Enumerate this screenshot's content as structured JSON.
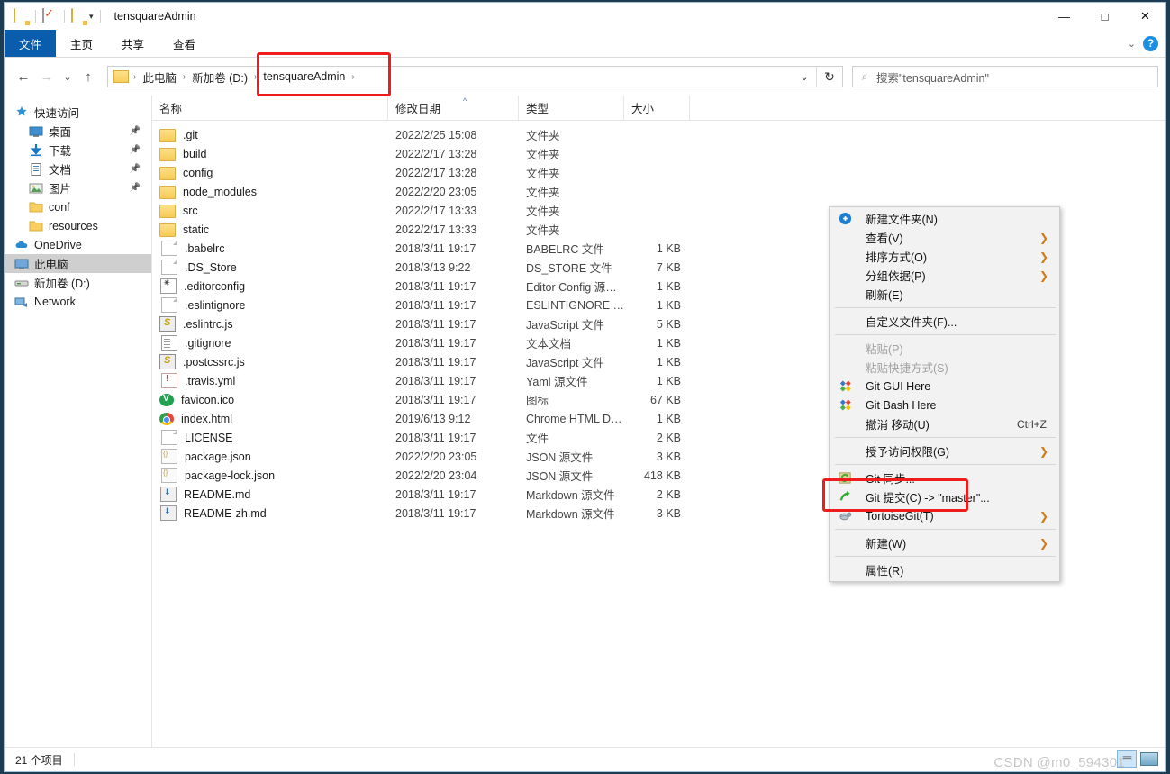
{
  "window": {
    "title": "tensquareAdmin",
    "quick_access_icons": [
      "folder-icon",
      "properties-icon",
      "folder-icon",
      "dropdown-caret-icon"
    ],
    "controls": {
      "minimize": "—",
      "maximize": "□",
      "close": "✕"
    }
  },
  "ribbon": {
    "tabs": [
      {
        "label": "文件",
        "active": true
      },
      {
        "label": "主页",
        "active": false
      },
      {
        "label": "共享",
        "active": false
      },
      {
        "label": "查看",
        "active": false
      }
    ],
    "collapse_caret": "⌄",
    "help_label": "?"
  },
  "addressbar": {
    "back": "←",
    "forward": "→",
    "recent": "⌄",
    "up": "↑",
    "crumbs": [
      "此电脑",
      "新加卷 (D:)",
      "tensquareAdmin"
    ],
    "separator": "›",
    "dropdown_caret": "⌄",
    "refresh": "↻"
  },
  "search": {
    "icon": "search-icon",
    "placeholder": "搜索\"tensquareAdmin\""
  },
  "sidebar": {
    "items": [
      {
        "label": "快速访问",
        "icon": "star-pin-icon",
        "indent": 10,
        "pinned": false,
        "selected": false
      },
      {
        "label": "桌面",
        "icon": "desktop-icon",
        "indent": 26,
        "pinned": true,
        "selected": false
      },
      {
        "label": "下载",
        "icon": "download-icon",
        "indent": 26,
        "pinned": true,
        "selected": false
      },
      {
        "label": "文档",
        "icon": "documents-icon",
        "indent": 26,
        "pinned": true,
        "selected": false
      },
      {
        "label": "图片",
        "icon": "pictures-icon",
        "indent": 26,
        "pinned": true,
        "selected": false
      },
      {
        "label": "conf",
        "icon": "folder-icon",
        "indent": 26,
        "pinned": false,
        "selected": false
      },
      {
        "label": "resources",
        "icon": "folder-icon",
        "indent": 26,
        "pinned": false,
        "selected": false
      },
      {
        "label": "OneDrive",
        "icon": "cloud-icon",
        "indent": 10,
        "pinned": false,
        "selected": false
      },
      {
        "label": "此电脑",
        "icon": "this-pc-icon",
        "indent": 10,
        "pinned": false,
        "selected": true
      },
      {
        "label": "新加卷 (D:)",
        "icon": "drive-icon",
        "indent": 10,
        "pinned": false,
        "selected": false
      },
      {
        "label": "Network",
        "icon": "network-icon",
        "indent": 10,
        "pinned": false,
        "selected": false
      }
    ]
  },
  "filelist": {
    "columns": [
      {
        "label": "名称",
        "key": "name"
      },
      {
        "label": "修改日期",
        "key": "date"
      },
      {
        "label": "类型",
        "key": "type"
      },
      {
        "label": "大小",
        "key": "size"
      }
    ],
    "sort_indicator": "^",
    "rows": [
      {
        "name": ".git",
        "date": "2022/2/25 15:08",
        "type": "文件夹",
        "size": "",
        "icon": "folder-icon"
      },
      {
        "name": "build",
        "date": "2022/2/17 13:28",
        "type": "文件夹",
        "size": "",
        "icon": "folder-icon"
      },
      {
        "name": "config",
        "date": "2022/2/17 13:28",
        "type": "文件夹",
        "size": "",
        "icon": "folder-icon"
      },
      {
        "name": "node_modules",
        "date": "2022/2/20 23:05",
        "type": "文件夹",
        "size": "",
        "icon": "folder-icon"
      },
      {
        "name": "src",
        "date": "2022/2/17 13:33",
        "type": "文件夹",
        "size": "",
        "icon": "folder-icon"
      },
      {
        "name": "static",
        "date": "2022/2/17 13:33",
        "type": "文件夹",
        "size": "",
        "icon": "folder-icon"
      },
      {
        "name": ".babelrc",
        "date": "2018/3/11 19:17",
        "type": "BABELRC 文件",
        "size": "1 KB",
        "icon": "generic-file-icon"
      },
      {
        "name": ".DS_Store",
        "date": "2018/3/13 9:22",
        "type": "DS_STORE 文件",
        "size": "7 KB",
        "icon": "generic-file-icon"
      },
      {
        "name": ".editorconfig",
        "date": "2018/3/11 19:17",
        "type": "Editor Config 源…",
        "size": "1 KB",
        "icon": "config-file-icon"
      },
      {
        "name": ".eslintignore",
        "date": "2018/3/11 19:17",
        "type": "ESLINTIGNORE …",
        "size": "1 KB",
        "icon": "generic-file-icon"
      },
      {
        "name": ".eslintrc.js",
        "date": "2018/3/11 19:17",
        "type": "JavaScript 文件",
        "size": "5 KB",
        "icon": "javascript-file-icon"
      },
      {
        "name": ".gitignore",
        "date": "2018/3/11 19:17",
        "type": "文本文档",
        "size": "1 KB",
        "icon": "text-file-icon"
      },
      {
        "name": ".postcssrc.js",
        "date": "2018/3/11 19:17",
        "type": "JavaScript 文件",
        "size": "1 KB",
        "icon": "javascript-file-icon"
      },
      {
        "name": ".travis.yml",
        "date": "2018/3/11 19:17",
        "type": "Yaml 源文件",
        "size": "1 KB",
        "icon": "yaml-file-icon"
      },
      {
        "name": "favicon.ico",
        "date": "2018/3/11 19:17",
        "type": "图标",
        "size": "67 KB",
        "icon": "favicon-icon"
      },
      {
        "name": "index.html",
        "date": "2019/6/13 9:12",
        "type": "Chrome HTML D…",
        "size": "1 KB",
        "icon": "chrome-html-icon"
      },
      {
        "name": "LICENSE",
        "date": "2018/3/11 19:17",
        "type": "文件",
        "size": "2 KB",
        "icon": "generic-file-icon"
      },
      {
        "name": "package.json",
        "date": "2022/2/20 23:05",
        "type": "JSON 源文件",
        "size": "3 KB",
        "icon": "json-file-icon"
      },
      {
        "name": "package-lock.json",
        "date": "2022/2/20 23:04",
        "type": "JSON 源文件",
        "size": "418 KB",
        "icon": "json-file-icon"
      },
      {
        "name": "README.md",
        "date": "2018/3/11 19:17",
        "type": "Markdown 源文件",
        "size": "2 KB",
        "icon": "markdown-file-icon"
      },
      {
        "name": "README-zh.md",
        "date": "2018/3/11 19:17",
        "type": "Markdown 源文件",
        "size": "3 KB",
        "icon": "markdown-file-icon"
      }
    ]
  },
  "contextmenu": {
    "items": [
      {
        "label": "新建文件夹(N)",
        "icon": "new-folder-icon",
        "arrow": false,
        "accel": "",
        "disabled": false,
        "sep_after": false,
        "highlight": false
      },
      {
        "label": "查看(V)",
        "icon": "",
        "arrow": true,
        "accel": "",
        "disabled": false,
        "sep_after": false,
        "highlight": false
      },
      {
        "label": "排序方式(O)",
        "icon": "",
        "arrow": true,
        "accel": "",
        "disabled": false,
        "sep_after": false,
        "highlight": false
      },
      {
        "label": "分组依据(P)",
        "icon": "",
        "arrow": true,
        "accel": "",
        "disabled": false,
        "sep_after": false,
        "highlight": false
      },
      {
        "label": "刷新(E)",
        "icon": "",
        "arrow": false,
        "accel": "",
        "disabled": false,
        "sep_after": true,
        "highlight": false
      },
      {
        "label": "自定义文件夹(F)...",
        "icon": "",
        "arrow": false,
        "accel": "",
        "disabled": false,
        "sep_after": true,
        "highlight": false
      },
      {
        "label": "粘贴(P)",
        "icon": "",
        "arrow": false,
        "accel": "",
        "disabled": true,
        "sep_after": false,
        "highlight": false
      },
      {
        "label": "粘贴快捷方式(S)",
        "icon": "",
        "arrow": false,
        "accel": "",
        "disabled": true,
        "sep_after": false,
        "highlight": false
      },
      {
        "label": "Git GUI Here",
        "icon": "git-logo-icon",
        "arrow": false,
        "accel": "",
        "disabled": false,
        "sep_after": false,
        "highlight": false
      },
      {
        "label": "Git Bash Here",
        "icon": "git-logo-icon",
        "arrow": false,
        "accel": "",
        "disabled": false,
        "sep_after": false,
        "highlight": false
      },
      {
        "label": "撤消 移动(U)",
        "icon": "",
        "arrow": false,
        "accel": "Ctrl+Z",
        "disabled": false,
        "sep_after": true,
        "highlight": false
      },
      {
        "label": "授予访问权限(G)",
        "icon": "",
        "arrow": true,
        "accel": "",
        "disabled": false,
        "sep_after": true,
        "highlight": false
      },
      {
        "label": "Git 同步...",
        "icon": "git-sync-icon",
        "arrow": false,
        "accel": "",
        "disabled": false,
        "sep_after": false,
        "highlight": true
      },
      {
        "label": "Git 提交(C) -> \"master\"...",
        "icon": "git-commit-icon",
        "arrow": false,
        "accel": "",
        "disabled": false,
        "sep_after": false,
        "highlight": false
      },
      {
        "label": "TortoiseGit(T)",
        "icon": "tortoisegit-icon",
        "arrow": true,
        "accel": "",
        "disabled": false,
        "sep_after": true,
        "highlight": false
      },
      {
        "label": "新建(W)",
        "icon": "",
        "arrow": true,
        "accel": "",
        "disabled": false,
        "sep_after": true,
        "highlight": false
      },
      {
        "label": "属性(R)",
        "icon": "",
        "arrow": false,
        "accel": "",
        "disabled": false,
        "sep_after": false,
        "highlight": false
      }
    ]
  },
  "statusbar": {
    "item_count": "21 个项目",
    "view_details_icon": "details-view-icon",
    "view_large_icon": "large-icons-view-icon"
  },
  "watermark": {
    "text": "CSDN @m0_594301"
  },
  "accent": {
    "selection_blue": "#0a5dac",
    "highlight_red": "#ee1c1c",
    "folder_yellow": "#f7ca56"
  }
}
